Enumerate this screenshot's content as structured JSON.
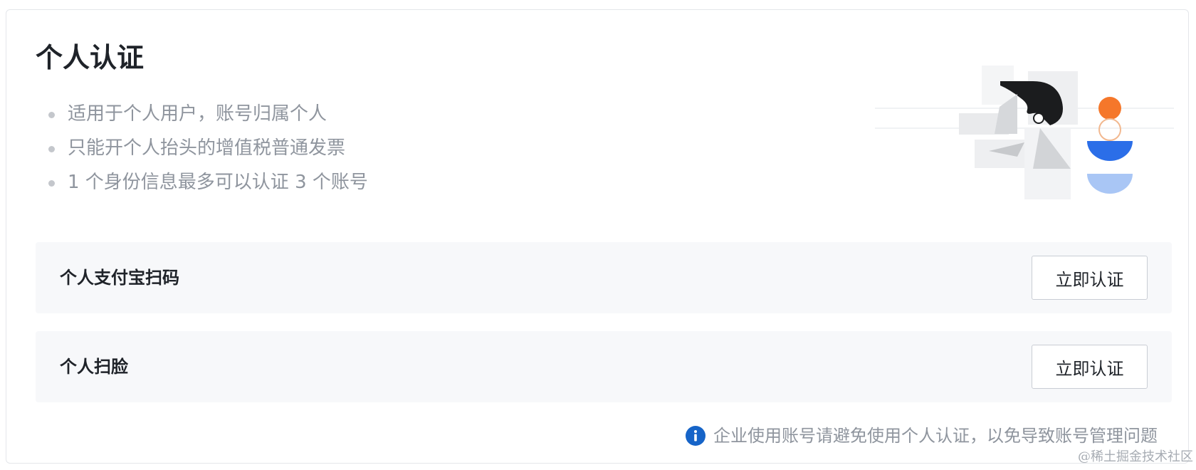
{
  "header": {
    "title": "个人认证"
  },
  "features": [
    "适用于个人用户，账号归属个人",
    "只能开个人抬头的增值税普通发票",
    "1 个身份信息最多可以认证 3 个账号"
  ],
  "options": [
    {
      "label": "个人支付宝扫码",
      "button_label": "立即认证"
    },
    {
      "label": "个人扫脸",
      "button_label": "立即认证"
    }
  ],
  "notice": {
    "text": "企业使用账号请避免使用个人认证，以免导致账号管理问题",
    "icon": "info-circle-icon"
  },
  "watermark": "@稀土掘金技术社区",
  "colors": {
    "accent_orange": "#f5772a",
    "accent_blue": "#2b6ee8",
    "accent_light_blue": "#a9c6f5",
    "info_blue": "#1664c8"
  }
}
